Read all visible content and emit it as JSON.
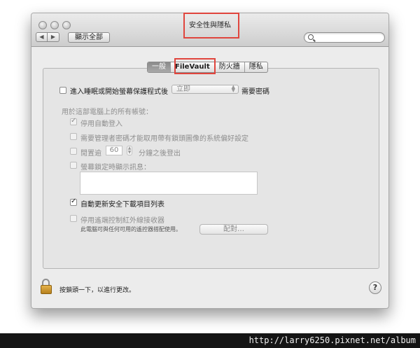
{
  "window": {
    "title": "安全性與隱私",
    "nav_back": "◀",
    "nav_forward": "▶",
    "show_all": "顯示全部",
    "search_placeholder": ""
  },
  "tabs": [
    {
      "label": "一般",
      "selected": true
    },
    {
      "label": "FileVault",
      "selected": false
    },
    {
      "label": "防火牆",
      "selected": false
    },
    {
      "label": "隱私",
      "selected": false
    }
  ],
  "general": {
    "require_password": {
      "checked": false,
      "label": "進入睡眠或開始螢幕保護程式後",
      "select_value": "立即",
      "suffix": "需要密碼"
    },
    "accounts_heading": "用於這部電腦上的所有帳號：",
    "disable_auto_login": {
      "checked": true,
      "label": "停用自動登入"
    },
    "require_admin": {
      "checked": false,
      "label": "需要管理者密碼才能取用帶有鎖頭圖像的系統偏好設定"
    },
    "logout_after": {
      "checked": false,
      "prefix": "閒置逾",
      "value": "60",
      "suffix": "分鐘之後登出"
    },
    "show_message": {
      "checked": false,
      "label": "螢幕鎖定時顯示訊息："
    },
    "auto_update": {
      "checked": true,
      "label": "自動更新安全下載項目列表"
    },
    "disable_ir": {
      "checked": false,
      "label": "停用遙端控制紅外線接收器"
    },
    "ir_note": "此電腦可與任何可用的遙控器搭配使用。",
    "pair_button": "配對…"
  },
  "footer": {
    "lock_text": "按鎖頭一下，以進行更改。",
    "help": "?",
    "watermark": "http://larry6250.pixnet.net/album"
  },
  "colors": {
    "annotation": "#e0453d",
    "window_bg": "#ececec",
    "footer_bar": "#151515"
  }
}
